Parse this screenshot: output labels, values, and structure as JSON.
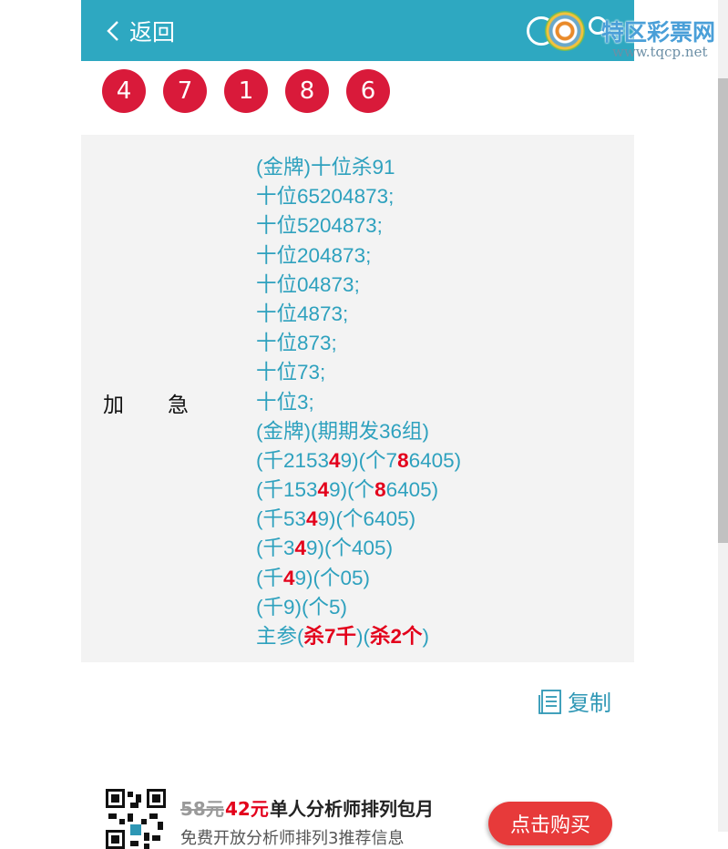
{
  "header": {
    "back_label": "返回",
    "logo": {
      "name": "特区彩票网",
      "url": "www.tqcp.net"
    }
  },
  "numbers": [
    "4",
    "7",
    "1",
    "8",
    "6"
  ],
  "panel": {
    "tag_left": "加",
    "tag_right": "急",
    "lines": [
      [
        {
          "t": "(金牌)十位杀91"
        }
      ],
      [
        {
          "t": "十位65204873;"
        }
      ],
      [
        {
          "t": "十位5204873;"
        }
      ],
      [
        {
          "t": "十位204873;"
        }
      ],
      [
        {
          "t": "十位04873;"
        }
      ],
      [
        {
          "t": "十位4873;"
        }
      ],
      [
        {
          "t": "十位873;"
        }
      ],
      [
        {
          "t": "十位73;"
        }
      ],
      [
        {
          "t": "十位3;"
        }
      ],
      [
        {
          "t": "(金牌)(期期发36组)"
        }
      ],
      [
        {
          "t": "(千2153"
        },
        {
          "t": "4",
          "hl": true
        },
        {
          "t": "9)(个7"
        },
        {
          "t": "8",
          "hl": true
        },
        {
          "t": "6405)"
        }
      ],
      [
        {
          "t": "(千153"
        },
        {
          "t": "4",
          "hl": true
        },
        {
          "t": "9)(个"
        },
        {
          "t": "8",
          "hl": true
        },
        {
          "t": "6405)"
        }
      ],
      [
        {
          "t": "(千53"
        },
        {
          "t": "4",
          "hl": true
        },
        {
          "t": "9)(个6405)"
        }
      ],
      [
        {
          "t": "(千3"
        },
        {
          "t": "4",
          "hl": true
        },
        {
          "t": "9)(个405)"
        }
      ],
      [
        {
          "t": "(千"
        },
        {
          "t": "4",
          "hl": true
        },
        {
          "t": "9)(个05)"
        }
      ],
      [
        {
          "t": "(千9)(个5)"
        }
      ],
      [
        {
          "t": "主参("
        },
        {
          "t": "杀7千",
          "hl": true
        },
        {
          "t": ")("
        },
        {
          "t": "杀2个",
          "hl": true
        },
        {
          "t": ")"
        }
      ]
    ]
  },
  "copy_label": "复制",
  "promo": {
    "old_price": "58元",
    "new_price": "42元",
    "title": "单人分析师排列包月",
    "subtitle": "免费开放分析师排列3推荐信息",
    "buy_label": "点击购买"
  },
  "colors": {
    "header_bg": "#2ea8c1",
    "ball": "#d91a3a",
    "text_blue": "#2ea1be",
    "highlight_red": "#e3001b",
    "buy_button": "#e73a3a"
  }
}
